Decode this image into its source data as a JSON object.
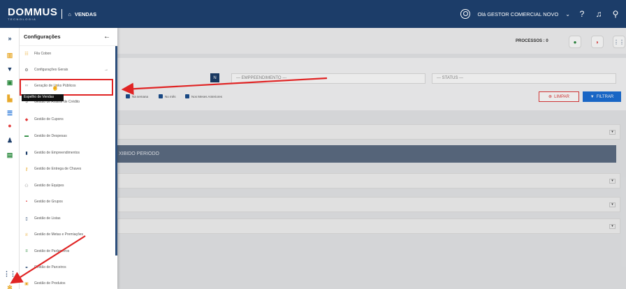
{
  "topbar": {
    "logo": "DOMMUS",
    "logo_sub": "TECNOLOGIA",
    "module": "VENDAS",
    "user_greeting": "Olá GESTOR COMERCIAL NOVO"
  },
  "drawer": {
    "title": "Configurações",
    "items": [
      {
        "label": "Fila Cobon",
        "icon": "list-icon",
        "color": "#e8a92b"
      },
      {
        "label": "Configurações Gerais",
        "icon": "gears-icon",
        "color": "#666666"
      },
      {
        "label": "Geração de Links Públicos",
        "icon": "link-icon",
        "color": "#999999"
      },
      {
        "label": "Gestão de Análise de Crédito",
        "icon": "money-icon",
        "color": "#888888"
      },
      {
        "label": "Gestão de Cupons",
        "icon": "tag-icon",
        "color": "#e23c3c"
      },
      {
        "label": "Gestão de Despesas",
        "icon": "wallet-icon",
        "color": "#2b8a3e"
      },
      {
        "label": "Gestão de Empreendimentos",
        "icon": "building-icon",
        "color": "#1c3d69"
      },
      {
        "label": "Gestão de Entrega de Chaves",
        "icon": "key-icon",
        "color": "#e8a92b"
      },
      {
        "label": "Gestão de Equipes",
        "icon": "team-icon",
        "color": "#888888"
      },
      {
        "label": "Gestão de Grupos",
        "icon": "group-icon",
        "color": "#e23c3c"
      },
      {
        "label": "Gestão de Listas",
        "icon": "list-icon",
        "color": "#1c3d69"
      },
      {
        "label": "Gestão de Metas e Premiações",
        "icon": "trophy-icon",
        "color": "#e8a92b"
      },
      {
        "label": "Gestão de Parâmetros",
        "icon": "sliders-icon",
        "color": "#2b8a3e"
      },
      {
        "label": "Gestão de Parceiros",
        "icon": "handshake-icon",
        "color": "#1c3d69"
      },
      {
        "label": "Gestão de Produtos",
        "icon": "box-icon",
        "color": "#e8a92b"
      }
    ],
    "tooltip": "Espelho de Vendas"
  },
  "main": {
    "processos": "PROCESSOS : 0",
    "n_label": "N",
    "empreendimento_placeholder": "--- EMPPEENDIMENTO ---",
    "status_placeholder": "--- STATUS ---",
    "checks": [
      "Na semana",
      "No mês",
      "Nos Meses Anteriores"
    ],
    "limpar": "LIMPAR",
    "filtrar": "FILTRAR",
    "period_text": "XIBIDO PERIODO"
  },
  "colors": {
    "topbar": "#1c3d69",
    "highlight": "#e02424",
    "accent": "#1c6fd6"
  }
}
